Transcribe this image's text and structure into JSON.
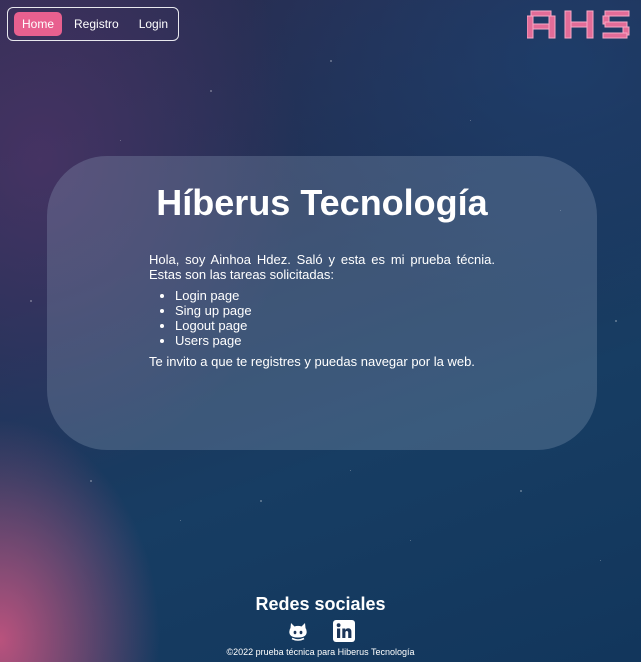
{
  "nav": {
    "items": [
      {
        "label": "Home",
        "active": true
      },
      {
        "label": "Registro",
        "active": false
      },
      {
        "label": "Login",
        "active": false
      }
    ],
    "active_color": "#e8608f"
  },
  "logo": {
    "text": "AHS",
    "color": "#e36c98"
  },
  "main": {
    "title": "Híberus Tecnología",
    "intro": "Hola, soy Ainhoa Hdez. Saló y esta es mi prueba técnia. Estas son las tareas solicitadas:",
    "tasks": [
      "Login page",
      "Sing up page",
      "Logout page",
      "Users page"
    ],
    "invite": "Te invito a que te registres y puedas navegar por la web."
  },
  "footer": {
    "title": "Redes sociales",
    "icons": [
      "github-icon",
      "linkedin-icon"
    ],
    "copyright": "©2022 prueba técnica para Hiberus Tecnología"
  }
}
